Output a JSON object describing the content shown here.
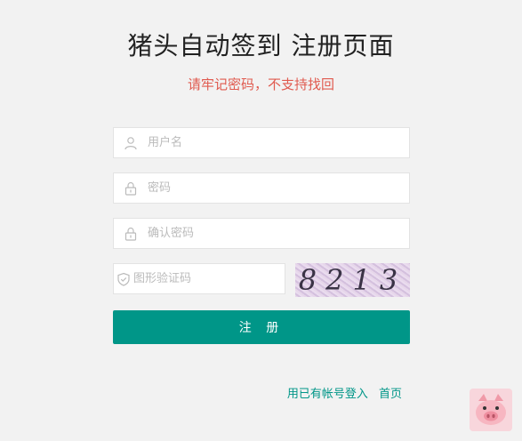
{
  "page": {
    "title": "猪头自动签到 注册页面",
    "subtitle": "请牢记密码，不支持找回"
  },
  "form": {
    "username_placeholder": "用户名",
    "password_placeholder": "密码",
    "confirm_placeholder": "确认密码",
    "captcha_placeholder": "图形验证码",
    "captcha_text": "8213",
    "register_label": "注 册"
  },
  "links": {
    "login_label": "用已有帐号登入",
    "home_label": "首页"
  },
  "icons": {
    "username": "user-icon",
    "password": "lock-icon",
    "confirm": "lock-icon",
    "captcha": "shield-icon",
    "mascot": "pig-icon"
  },
  "colors": {
    "accent": "#009688",
    "warning_text": "#e05a4f",
    "background": "#f2f2f2"
  }
}
